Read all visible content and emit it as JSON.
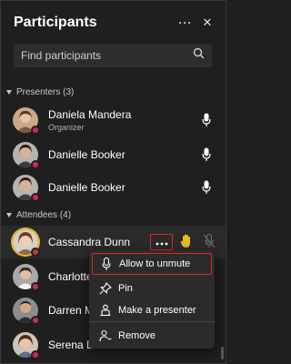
{
  "header": {
    "title": "Participants",
    "more_label": "···",
    "close_label": "✕"
  },
  "search": {
    "placeholder": "Find participants"
  },
  "presenters": {
    "label": "Presenters (3)",
    "people": [
      {
        "name": "Daniela Mandera",
        "role": "Organizer"
      },
      {
        "name": "Danielle Booker",
        "role": ""
      },
      {
        "name": "Danielle Booker",
        "role": ""
      }
    ]
  },
  "attendees": {
    "label": "Attendees (4)",
    "people": [
      {
        "name": "Cassandra Dunn"
      },
      {
        "name": "Charlotte"
      },
      {
        "name": "Darren M"
      },
      {
        "name": "Serena Davis"
      }
    ]
  },
  "context_menu": {
    "items": [
      {
        "label": "Allow to unmute",
        "icon": "microphone-icon"
      },
      {
        "label": "Pin",
        "icon": "pin-icon"
      },
      {
        "label": "Make a presenter",
        "icon": "presenter-icon"
      },
      {
        "label": "Remove",
        "icon": "remove-person-icon"
      }
    ]
  },
  "colors": {
    "background": "#1f1f1f",
    "highlight_border": "#e02424",
    "status_busy": "#c4314b",
    "raised_hand": "#e8b923"
  }
}
